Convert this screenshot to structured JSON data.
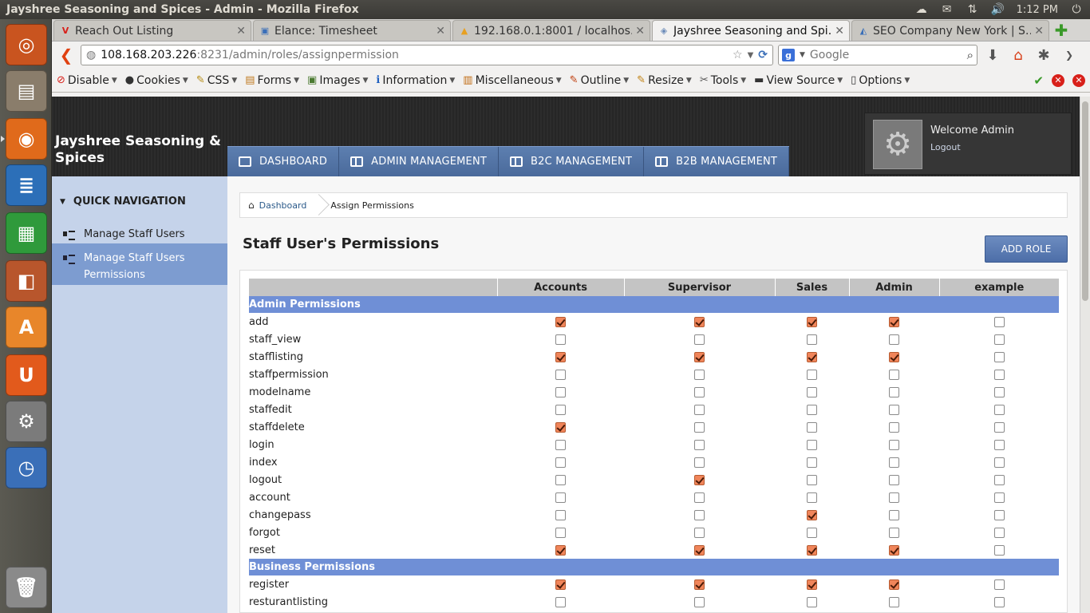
{
  "os": {
    "window_title": "Jayshree Seasoning and Spices - Admin - Mozilla Firefox",
    "clock": "1:12 PM"
  },
  "launcher": [
    {
      "name": "ubuntu-dash",
      "color": "#c9541f",
      "glyph": "◎"
    },
    {
      "name": "files",
      "color": "#8a7d6b",
      "glyph": "▤"
    },
    {
      "name": "firefox",
      "color": "#e06a1b",
      "glyph": "◉"
    },
    {
      "name": "writer",
      "color": "#2c6fb8",
      "glyph": "≣"
    },
    {
      "name": "calc",
      "color": "#2f9a3b",
      "glyph": "▦"
    },
    {
      "name": "impress",
      "color": "#b8562c",
      "glyph": "◧"
    },
    {
      "name": "software-center",
      "color": "#e8862a",
      "glyph": "A"
    },
    {
      "name": "ubuntu-one",
      "color": "#e25a1c",
      "glyph": "U"
    },
    {
      "name": "system-settings",
      "color": "#7b7b7b",
      "glyph": "⚙"
    },
    {
      "name": "clock-app",
      "color": "#3a6fb8",
      "glyph": "◷"
    },
    {
      "name": "trash",
      "color": "#8a8a8a",
      "glyph": "🗑"
    }
  ],
  "browser": {
    "tabs": [
      {
        "label": "Reach Out Listing",
        "fav": "V",
        "fav_color": "#d8201a",
        "active": false
      },
      {
        "label": "Elance: Timesheet",
        "fav": "▣",
        "fav_color": "#3a6fb8",
        "active": false
      },
      {
        "label": "192.168.0.1:8001 / localhos…",
        "fav": "▲",
        "fav_color": "#e8a020",
        "active": false
      },
      {
        "label": "Jayshree Seasoning and Spi…",
        "fav": "◈",
        "fav_color": "#6a8ab8",
        "active": true
      },
      {
        "label": "SEO Company New York | S…",
        "fav": "◭",
        "fav_color": "#3a6fb8",
        "active": false
      }
    ],
    "url_host": "108.168.203.226",
    "url_path": ":8231/admin/roles/assignpermission",
    "search_placeholder": "Google",
    "devbar": [
      {
        "label": "Disable",
        "icon": "⊘",
        "color": "#d8201a"
      },
      {
        "label": "Cookies",
        "icon": "●",
        "color": "#333"
      },
      {
        "label": "CSS",
        "icon": "✎",
        "color": "#b58a10"
      },
      {
        "label": "Forms",
        "icon": "▤",
        "color": "#c07a20"
      },
      {
        "label": "Images",
        "icon": "▣",
        "color": "#4a7a30"
      },
      {
        "label": "Information",
        "icon": "ℹ",
        "color": "#2060c0"
      },
      {
        "label": "Miscellaneous",
        "icon": "▥",
        "color": "#c06a10"
      },
      {
        "label": "Outline",
        "icon": "✎",
        "color": "#c04010"
      },
      {
        "label": "Resize",
        "icon": "✎",
        "color": "#c08010"
      },
      {
        "label": "Tools",
        "icon": "✂",
        "color": "#555"
      },
      {
        "label": "View Source",
        "icon": "▬",
        "color": "#333"
      },
      {
        "label": "Options",
        "icon": "▯",
        "color": "#333"
      }
    ]
  },
  "app": {
    "brand": "Jayshree Seasoning & Spices",
    "nav": [
      "DASHBOARD",
      "ADMIN MANAGEMENT",
      "B2C MANAGEMENT",
      "B2B MANAGEMENT"
    ],
    "welcome": "Welcome Admin",
    "logout": "Logout",
    "sidebar": {
      "title": "QUICK NAVIGATION",
      "items": [
        "Manage Staff Users",
        "Manage Staff Users Permissions"
      ]
    },
    "breadcrumb": {
      "home": "Dashboard",
      "current": "Assign Permissions"
    },
    "page_title": "Staff User's Permissions",
    "add_role_label": "ADD ROLE",
    "roles": [
      "Accounts",
      "Supervisor",
      "Sales",
      "Admin",
      "example"
    ],
    "sections": [
      {
        "title": "Admin Permissions",
        "rows": [
          {
            "name": "add",
            "checks": [
              1,
              1,
              1,
              1,
              0
            ]
          },
          {
            "name": "staff_view",
            "checks": [
              0,
              0,
              0,
              0,
              0
            ]
          },
          {
            "name": "stafflisting",
            "checks": [
              1,
              1,
              1,
              1,
              0
            ]
          },
          {
            "name": "staffpermission",
            "checks": [
              0,
              0,
              0,
              0,
              0
            ]
          },
          {
            "name": "modelname",
            "checks": [
              0,
              0,
              0,
              0,
              0
            ]
          },
          {
            "name": "staffedit",
            "checks": [
              0,
              0,
              0,
              0,
              0
            ]
          },
          {
            "name": "staffdelete",
            "checks": [
              1,
              0,
              0,
              0,
              0
            ]
          },
          {
            "name": "login",
            "checks": [
              0,
              0,
              0,
              0,
              0
            ]
          },
          {
            "name": "index",
            "checks": [
              0,
              0,
              0,
              0,
              0
            ]
          },
          {
            "name": "logout",
            "checks": [
              0,
              1,
              0,
              0,
              0
            ]
          },
          {
            "name": "account",
            "checks": [
              0,
              0,
              0,
              0,
              0
            ]
          },
          {
            "name": "changepass",
            "checks": [
              0,
              0,
              1,
              0,
              0
            ]
          },
          {
            "name": "forgot",
            "checks": [
              0,
              0,
              0,
              0,
              0
            ]
          },
          {
            "name": "reset",
            "checks": [
              1,
              1,
              1,
              1,
              0
            ]
          }
        ]
      },
      {
        "title": "Business Permissions",
        "rows": [
          {
            "name": "register",
            "checks": [
              1,
              1,
              1,
              1,
              0
            ]
          },
          {
            "name": "resturantlisting",
            "checks": [
              0,
              0,
              0,
              0,
              0
            ]
          }
        ]
      }
    ]
  }
}
